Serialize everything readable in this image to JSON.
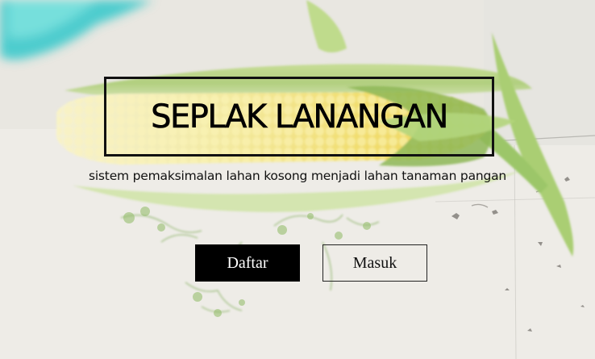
{
  "hero": {
    "title": "SEPLAK LANANGAN",
    "tagline": "sistem pemaksimalan lahan kosong menjadi lahan tanaman pangan"
  },
  "actions": {
    "register_label": "Daftar",
    "login_label": "Masuk"
  }
}
